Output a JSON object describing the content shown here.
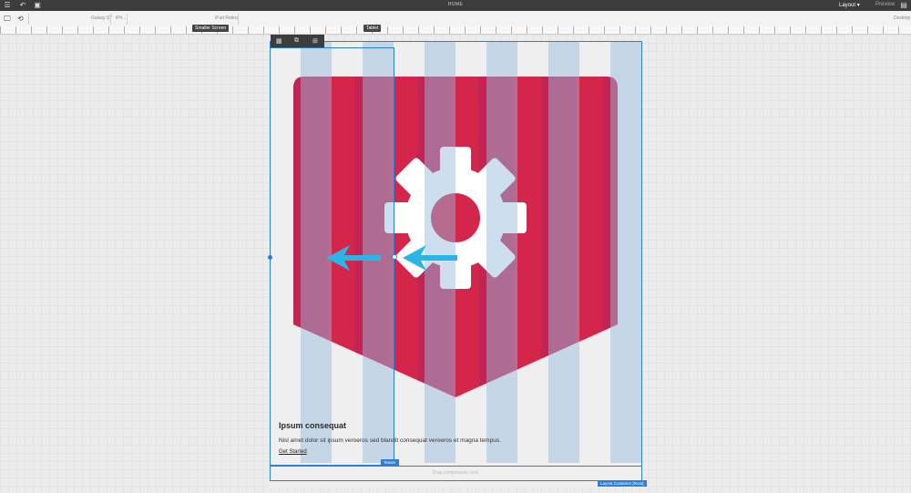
{
  "topbar": {
    "title": "HOME",
    "mode": "Layout",
    "mode_caret": "▾",
    "preview": "Preview",
    "icons": [
      "sidebar-toggle-icon",
      "undo-icon",
      "annotate-icon",
      "properties-icon"
    ]
  },
  "devices": {
    "galaxy": "Galaxy S7",
    "iphone": "iPh...",
    "ipad": "iPad Retina",
    "desktop": "Desktop"
  },
  "ruler": {
    "smaller_screen": "Smaller Screen",
    "tablet": "Tablet"
  },
  "component_toolbar": {
    "icons": [
      "layout-icon",
      "parent-icon",
      "group-icon"
    ]
  },
  "teaser": {
    "title": "Ipsum consequat",
    "description": "Nisl amet dolor sit ipsum veroeros sed blandit consequat veroeros et magna tempus.",
    "link": "Get Started",
    "tag": "Teaser"
  },
  "container": {
    "drag_hint": "Drag components here",
    "tag": "Layout Container [Root]"
  },
  "colors": {
    "accent": "#2d7fd3",
    "shield": "#d4254a",
    "arrow": "#29b6e6"
  }
}
